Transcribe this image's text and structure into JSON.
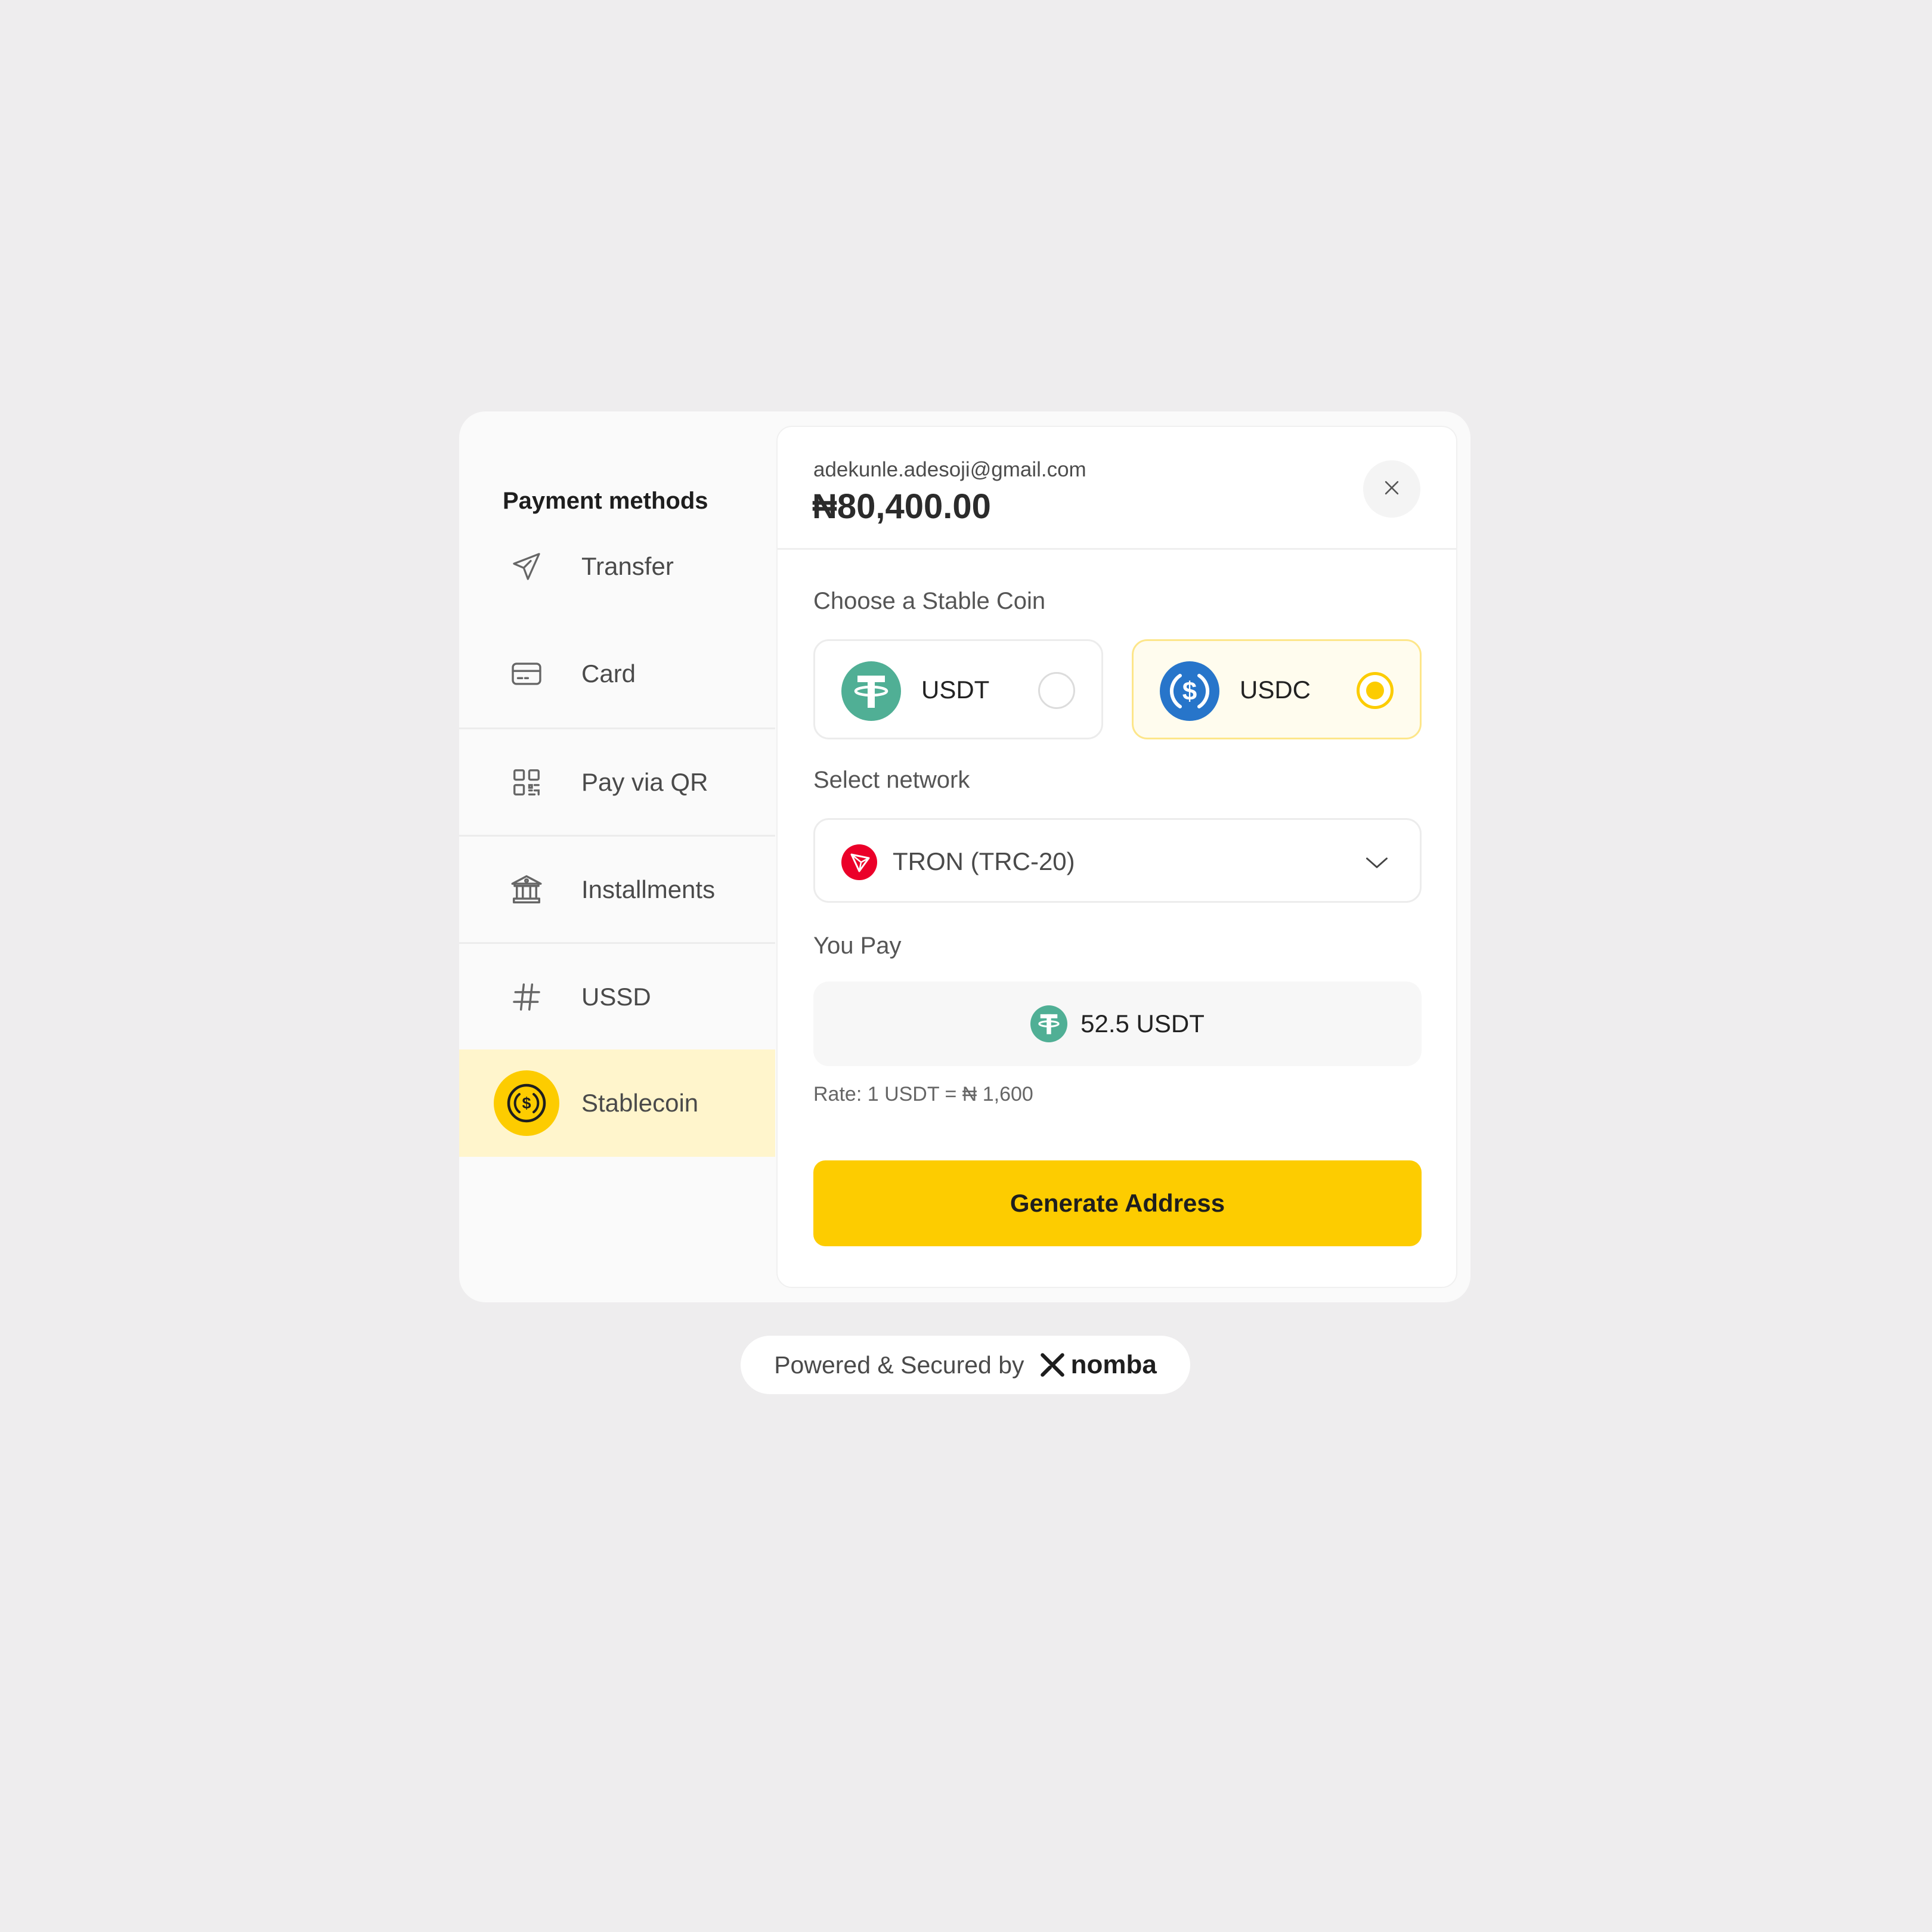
{
  "sidebar": {
    "title": "Payment methods",
    "items": [
      {
        "label": "Transfer",
        "icon": "send-icon"
      },
      {
        "label": "Card",
        "icon": "card-icon"
      },
      {
        "label": "Pay via QR",
        "icon": "qr-icon"
      },
      {
        "label": "Installments",
        "icon": "bank-icon"
      },
      {
        "label": "USSD",
        "icon": "hash-icon"
      },
      {
        "label": "Stablecoin",
        "icon": "stablecoin-icon",
        "active": true
      }
    ]
  },
  "header": {
    "email": "adekunle.adesoji@gmail.com",
    "amount": "₦80,400.00"
  },
  "coin_section": {
    "label": "Choose a Stable Coin",
    "options": [
      {
        "name": "USDT",
        "selected": false,
        "color": "#50af95"
      },
      {
        "name": "USDC",
        "selected": true,
        "color": "#2775ca"
      }
    ]
  },
  "network": {
    "label": "Select network",
    "value": "TRON (TRC-20)",
    "color": "#eb0029"
  },
  "payment": {
    "label": "You Pay",
    "value": "52.5 USDT",
    "rate": "Rate: 1 USDT = ₦ 1,600"
  },
  "action": {
    "generate_label": "Generate Address",
    "color": "#fdcc00"
  },
  "footer": {
    "text": "Powered & Secured by",
    "brand": "nomba"
  }
}
